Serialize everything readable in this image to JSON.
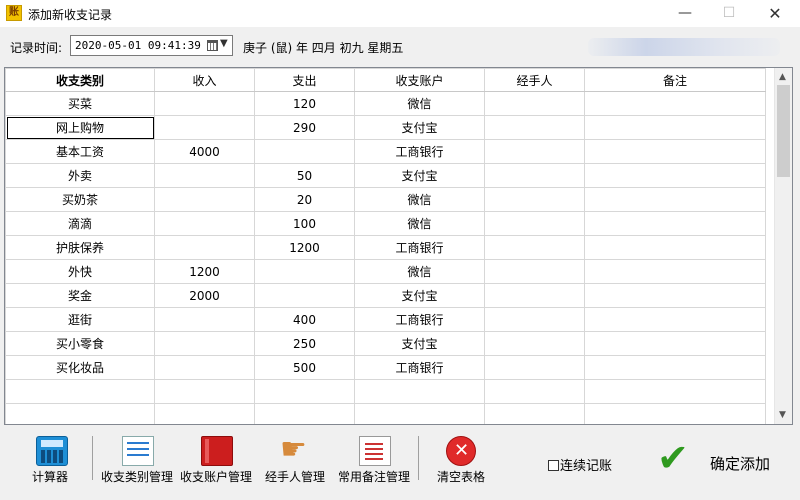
{
  "window": {
    "title": "添加新收支记录",
    "app_icon": "账"
  },
  "record_time": {
    "label": "记录时间:",
    "value": "2020-05-01 09:41:39",
    "lunar": "庚子 (鼠) 年  四月  初九  星期五"
  },
  "table": {
    "headers": [
      "收支类别",
      "收入",
      "支出",
      "收支账户",
      "经手人",
      "备注"
    ],
    "rows": [
      [
        "买菜",
        "",
        "120",
        "微信",
        "",
        ""
      ],
      [
        "网上购物",
        "",
        "290",
        "支付宝",
        "",
        ""
      ],
      [
        "基本工资",
        "4000",
        "",
        "工商银行",
        "",
        ""
      ],
      [
        "外卖",
        "",
        "50",
        "支付宝",
        "",
        ""
      ],
      [
        "买奶茶",
        "",
        "20",
        "微信",
        "",
        ""
      ],
      [
        "滴滴",
        "",
        "100",
        "微信",
        "",
        ""
      ],
      [
        "护肤保养",
        "",
        "1200",
        "工商银行",
        "",
        ""
      ],
      [
        "外快",
        "1200",
        "",
        "微信",
        "",
        ""
      ],
      [
        "奖金",
        "2000",
        "",
        "支付宝",
        "",
        ""
      ],
      [
        "逛街",
        "",
        "400",
        "工商银行",
        "",
        ""
      ],
      [
        "买小零食",
        "",
        "250",
        "支付宝",
        "",
        ""
      ],
      [
        "买化妆品",
        "",
        "500",
        "工商银行",
        "",
        ""
      ],
      [
        "",
        "",
        "",
        "",
        "",
        ""
      ],
      [
        "",
        "",
        "",
        "",
        "",
        ""
      ]
    ],
    "selected_cell": {
      "row": 1,
      "col": 0
    }
  },
  "toolbar": {
    "calculator": "计算器",
    "category_mgmt": "收支类别管理",
    "account_mgmt": "收支账户管理",
    "handler_mgmt": "经手人管理",
    "remark_mgmt": "常用备注管理",
    "clear_table": "清空表格"
  },
  "continuous": {
    "label": "连续记账",
    "checked": false
  },
  "confirm_label": "确定添加",
  "icons": {
    "calculator": "calculator-icon",
    "category": "checklist-icon",
    "account": "red-book-icon",
    "handler": "pointing-hand-icon",
    "remark": "notepad-icon",
    "clear": "red-x-icon",
    "confirm": "green-check-icon"
  }
}
